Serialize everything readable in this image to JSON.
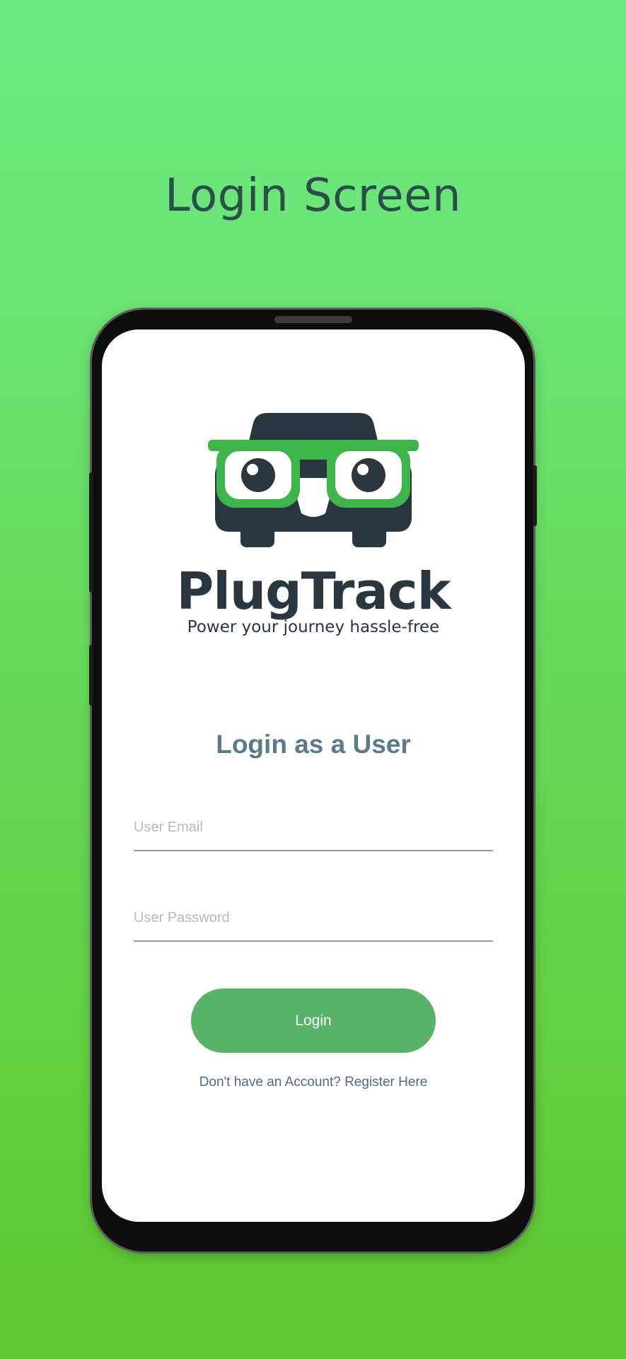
{
  "page": {
    "headline": "Login Screen",
    "background_color_top": "#6eeb86",
    "background_color_bottom": "#5fc72f"
  },
  "app": {
    "logo_icon": "car-with-glasses-icon",
    "logo_colors": {
      "dark": "#2b3740",
      "accent": "#3db54a"
    },
    "brand_name": "PlugTrack",
    "tagline": "Power your journey hassle-free"
  },
  "login_form": {
    "title": "Login as a User",
    "email": {
      "placeholder": "User Email",
      "value": ""
    },
    "password": {
      "placeholder": "User Password",
      "value": ""
    },
    "submit_label": "Login",
    "register_link": "Don't have an Account? Register Here",
    "button_color": "#58b368"
  }
}
